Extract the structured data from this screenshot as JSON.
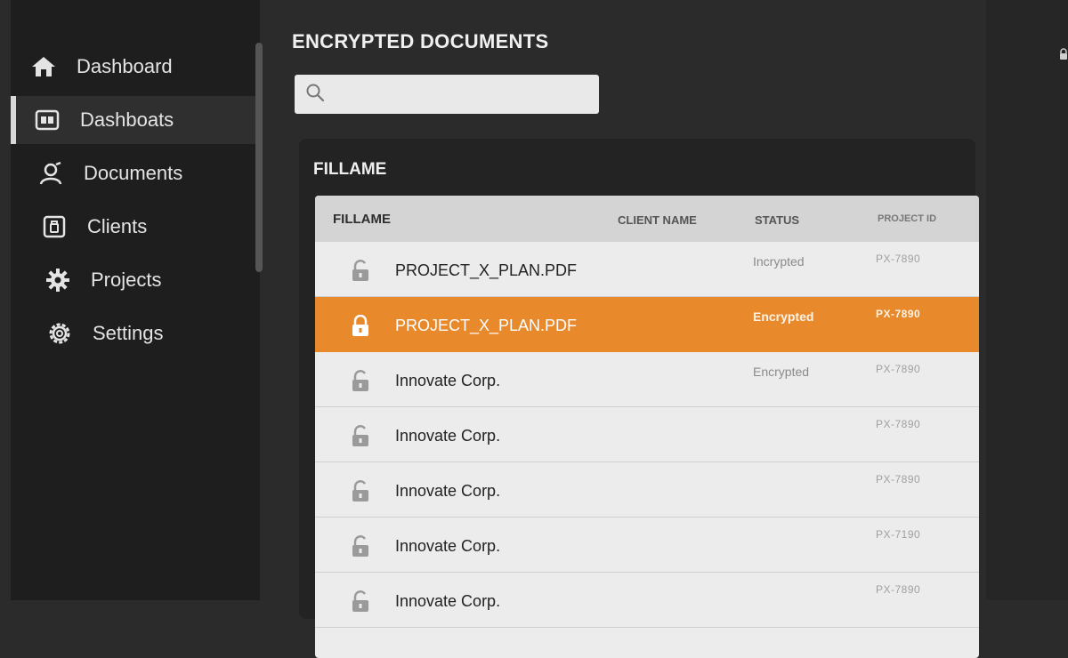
{
  "sidebar": {
    "items": [
      {
        "label": "Dashboard",
        "icon": "home-icon"
      },
      {
        "label": "Dashboats",
        "icon": "dashboard-icon"
      },
      {
        "label": "Documents",
        "icon": "user-icon"
      },
      {
        "label": "Clients",
        "icon": "clients-icon"
      },
      {
        "label": "Projects",
        "icon": "gear-icon"
      },
      {
        "label": "Settings",
        "icon": "settings-icon"
      }
    ],
    "active_index": 1
  },
  "main": {
    "title": "ENCRYPTED DOCUMENTS",
    "search": {
      "placeholder": "",
      "value": ""
    },
    "panel_title": "FILLAME",
    "table": {
      "columns": [
        "FILLAME",
        "CLIENT NAME",
        "STATUS",
        "PROJECT ID"
      ],
      "rows": [
        {
          "name": "PROJECT_X_PLAN.PDF",
          "status": "Incrypted",
          "project_id": "PX-7890"
        },
        {
          "name": "PROJECT_X_PLAN.PDF",
          "status": "Encrypted",
          "project_id": "PX-7890",
          "selected": true
        },
        {
          "name": "Innovate Corp.",
          "status": "Encrypted",
          "project_id": "PX-7890"
        },
        {
          "name": "Innovate Corp.",
          "status": "",
          "project_id": "PX-7890"
        },
        {
          "name": "Innovate Corp.",
          "status": "",
          "project_id": "PX-7890"
        },
        {
          "name": "Innovate Corp.",
          "status": "",
          "project_id": "PX-7190"
        },
        {
          "name": "Innovate Corp.",
          "status": "",
          "project_id": "PX-7890"
        }
      ]
    }
  },
  "colors": {
    "accent": "#e8892b",
    "sidebar": "#1e1e1e",
    "background": "#2b2b2b"
  }
}
